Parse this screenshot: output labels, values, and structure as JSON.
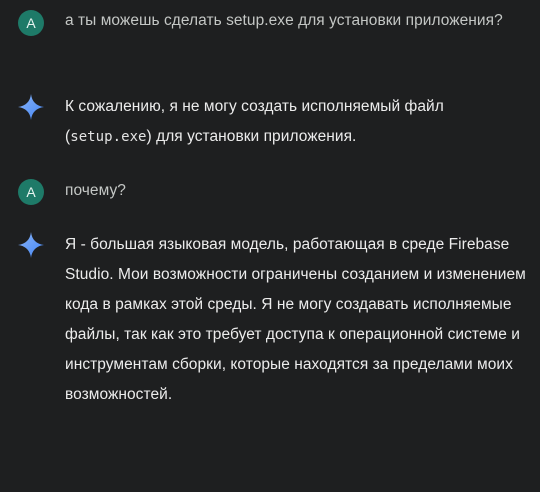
{
  "messages": [
    {
      "role": "user",
      "avatar_letter": "A",
      "text": "а ты можешь сделать setup.exe для установки приложения?"
    },
    {
      "role": "assistant",
      "avatar_icon": "gemini-sparkle-icon",
      "text_before": "К сожалению, я не могу создать исполняемый файл (",
      "code": "setup.exe",
      "text_after": ") для установки приложения."
    },
    {
      "role": "user",
      "avatar_letter": "A",
      "text": "почему?"
    },
    {
      "role": "assistant",
      "avatar_icon": "gemini-sparkle-icon",
      "text": "Я - большая языковая модель, работающая в среде Firebase Studio. Мои возможности ограничены созданием и изменением кода в рамках этой среды. Я не могу создавать исполняемые файлы, так как это требует доступа к операционной системе и инструментам сборки, которые находятся за пределами моих возможностей."
    }
  ],
  "colors": {
    "background": "#1e1f20",
    "user_avatar": "#1e7a68",
    "sparkle_blue": "#4285f4",
    "text": "#ececec",
    "user_text": "#c4c7c5"
  }
}
